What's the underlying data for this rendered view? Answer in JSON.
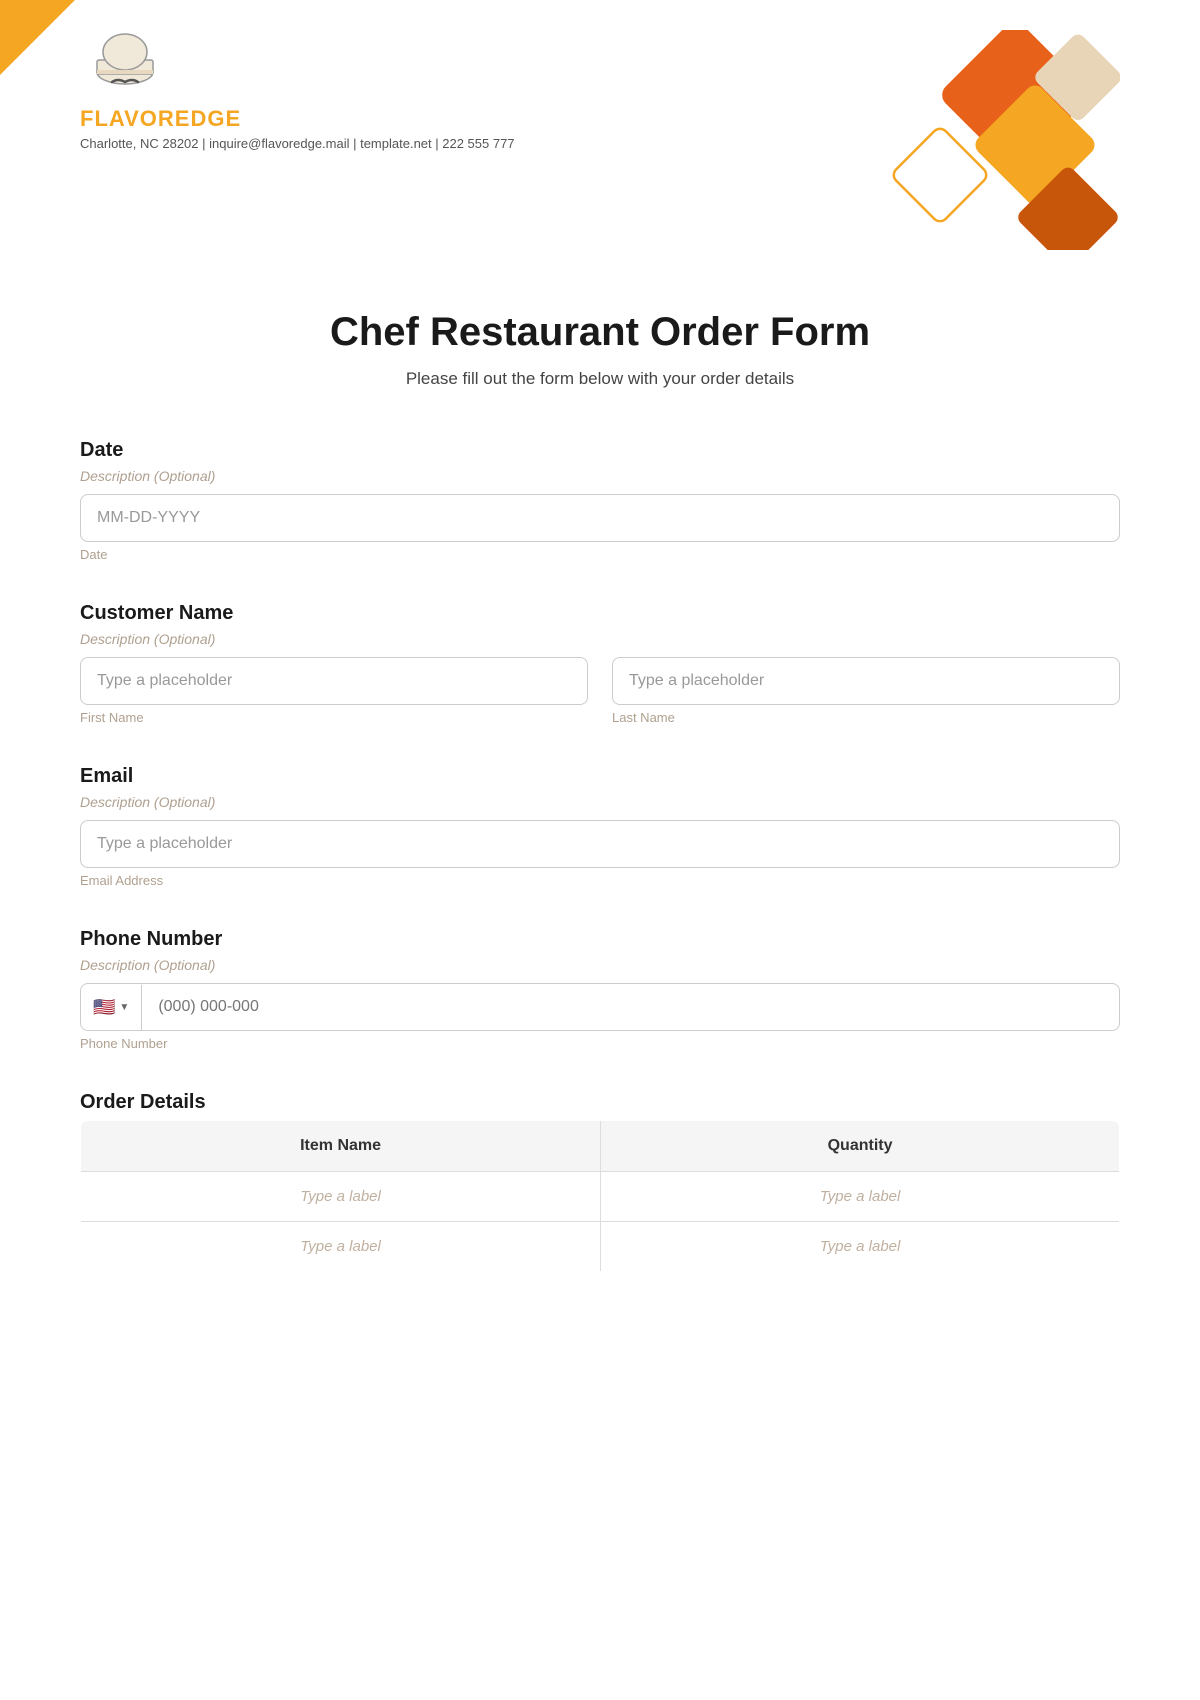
{
  "brand": {
    "name": "FLAVOREDGE",
    "info": "Charlotte, NC 28202 | inquire@flavoredge.mail | template.net | 222 555 777"
  },
  "form": {
    "title": "Chef Restaurant Order Form",
    "subtitle": "Please fill out the form below with your order details",
    "fields": {
      "date": {
        "label": "Date",
        "desc": "Description (Optional)",
        "placeholder": "MM-DD-YYYY",
        "sublabel": "Date"
      },
      "customer_name": {
        "label": "Customer Name",
        "desc": "Description (Optional)",
        "first_placeholder": "Type a placeholder",
        "last_placeholder": "Type a placeholder",
        "first_sublabel": "First Name",
        "last_sublabel": "Last Name"
      },
      "email": {
        "label": "Email",
        "desc": "Description (Optional)",
        "placeholder": "Type a placeholder",
        "sublabel": "Email Address"
      },
      "phone": {
        "label": "Phone Number",
        "desc": "Description (Optional)",
        "placeholder": "(000) 000-000",
        "sublabel": "Phone Number",
        "country_flag": "🇺🇸"
      },
      "order_details": {
        "label": "Order Details",
        "table": {
          "headers": [
            "Item Name",
            "Quantity"
          ],
          "rows": [
            [
              "Type a label",
              "Type a label"
            ],
            [
              "Type a label",
              "Type a label"
            ]
          ]
        }
      }
    }
  },
  "decorative": {
    "colors": {
      "orange_dark": "#E8611A",
      "orange_mid": "#F5A623",
      "orange_light": "#F7C26B",
      "beige": "#E8D5B7"
    }
  }
}
